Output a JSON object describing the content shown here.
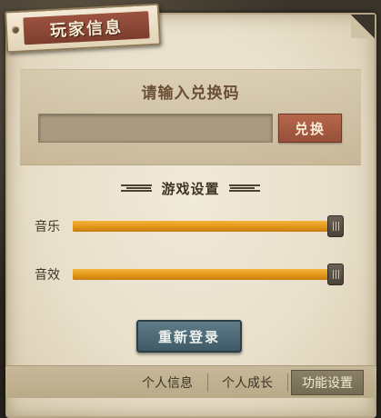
{
  "title": "玩家信息",
  "redeem": {
    "title": "请输入兑换码",
    "input_value": "",
    "input_placeholder": "",
    "button_label": "兑换"
  },
  "settings": {
    "title": "游戏设置",
    "music": {
      "label": "音乐",
      "level_percent": 100
    },
    "sfx": {
      "label": "音效",
      "level_percent": 100
    }
  },
  "relogin_label": "重新登录",
  "tabs": [
    {
      "label": "个人信息",
      "active": false
    },
    {
      "label": "个人成长",
      "active": false
    },
    {
      "label": "功能设置",
      "active": true
    }
  ],
  "colors": {
    "slider_fill": "#e09417",
    "redeem_button": "#98503a",
    "relogin_button": "#3f5a66",
    "title_tag": "#7c3d2d"
  }
}
